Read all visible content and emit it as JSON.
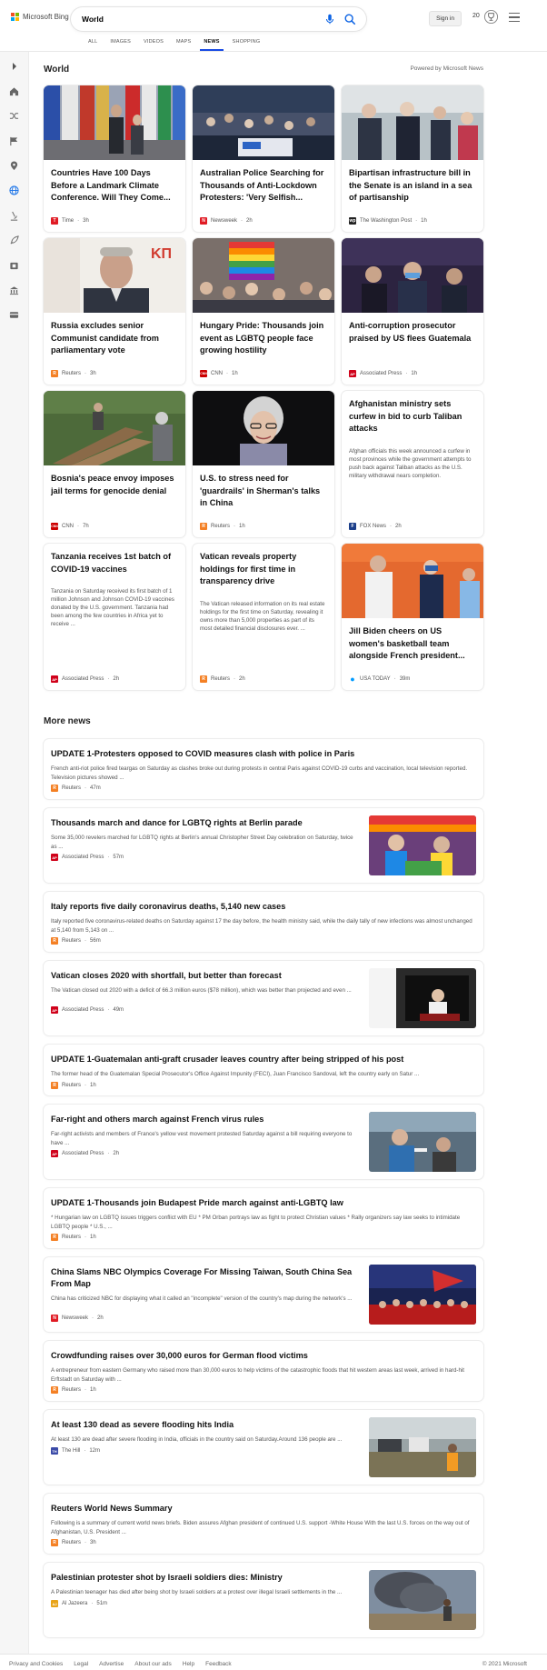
{
  "header": {
    "brand": "Microsoft Bing",
    "search_value": "World",
    "signin_label": "Sign in",
    "rewards_count": "20",
    "colors": {
      "accent": "#174ae4",
      "mic": "#0c63e4"
    }
  },
  "tabs": [
    "ALL",
    "IMAGES",
    "VIDEOS",
    "MAPS",
    "NEWS",
    "SHOPPING"
  ],
  "active_tab": "NEWS",
  "sidebar_icons": [
    "expand-icon",
    "home-icon",
    "shuffle-icon",
    "flag-icon",
    "location-pin-icon",
    "globe-icon",
    "microscope-icon",
    "rocket-icon",
    "film-icon",
    "bank-icon",
    "card-icon"
  ],
  "section": {
    "title": "World",
    "powered_by": "Powered by Microsoft News"
  },
  "cards": [
    {
      "headline": "Countries Have 100 Days Before a Landmark Climate Conference. Will They Come...",
      "source": "Time",
      "age": "3h",
      "logo": "T",
      "logo_color": "#e01b24"
    },
    {
      "headline": "Australian Police Searching for Thousands of Anti-Lockdown Protesters: 'Very Selfish...",
      "source": "Newsweek",
      "age": "2h",
      "logo": "N",
      "logo_color": "#e01b24"
    },
    {
      "headline": "Bipartisan infrastructure bill in the Senate is an island in a sea of partisanship",
      "source": "The Washington Post",
      "age": "1h",
      "logo": "wp",
      "logo_color": "#222222"
    },
    {
      "headline": "Russia excludes senior Communist candidate from parliamentary vote",
      "source": "Reuters",
      "age": "3h",
      "logo": "R",
      "logo_color": "#f48024"
    },
    {
      "headline": "Hungary Pride: Thousands join event as LGBTQ people face growing hostility",
      "source": "CNN",
      "age": "1h",
      "logo": "CNN",
      "logo_color": "#cc0000"
    },
    {
      "headline": "Anti-corruption prosecutor praised by US flees Guatemala",
      "source": "Associated Press",
      "age": "1h",
      "logo": "AP",
      "logo_color": "#d0021b"
    },
    {
      "headline": "Bosnia's peace envoy imposes jail terms for genocide denial",
      "source": "CNN",
      "age": "7h",
      "logo": "CNN",
      "logo_color": "#cc0000"
    },
    {
      "headline": "U.S. to stress need for 'guardrails' in Sherman's talks in China",
      "source": "Reuters",
      "age": "1h",
      "logo": "R",
      "logo_color": "#f48024"
    },
    {
      "headline": "Afghanistan ministry sets curfew in bid to curb Taliban attacks",
      "snippet": "Afghan officials this week announced a curfew in most provinces while the government attempts to push back against Taliban attacks as the U.S. military withdrawal nears completion.",
      "source": "FOX News",
      "age": "2h",
      "logo": "F",
      "logo_color": "#1c3f8a"
    },
    {
      "headline": "Tanzania receives 1st batch of COVID-19 vaccines",
      "snippet": "Tanzania on Saturday received its first batch of 1 million Johnson and Johnson COVID-19 vaccines donated by the U.S. government. Tanzania had been among the few countries in Africa yet to receive ...",
      "source": "Associated Press",
      "age": "2h",
      "logo": "AP",
      "logo_color": "#d0021b"
    },
    {
      "headline": "Vatican reveals property holdings for first time in transparency drive",
      "snippet": "The Vatican released information on its real estate holdings for the first time on Saturday, revealing it owns more than 5,000 properties as part of its most detailed financial disclosures ever. ...",
      "source": "Reuters",
      "age": "2h",
      "logo": "R",
      "logo_color": "#f48024"
    },
    {
      "headline": "Jill Biden cheers on US women's basketball team alongside French president...",
      "source": "USA TODAY",
      "age": "39m",
      "logo": "●",
      "logo_color": "#009bff"
    }
  ],
  "more_news": {
    "title": "More news",
    "items": [
      {
        "title": "UPDATE 1-Protesters opposed to COVID measures clash with police in Paris",
        "snippet": "French anti-riot police fired teargas on Saturday as clashes broke out during protests in central Paris against COVID-19 curbs and vaccination, local television reported. Television pictures showed ...",
        "source": "Reuters",
        "age": "47m",
        "logo": "R",
        "logo_color": "#f48024"
      },
      {
        "title": "Thousands march and dance for LGBTQ rights at Berlin parade",
        "snippet": "Some 35,000 revelers marched for LGBTQ rights at Berlin's annual Christopher Street Day celebration on Saturday, twice as ...",
        "source": "Associated Press",
        "age": "57m",
        "logo": "AP",
        "logo_color": "#d0021b"
      },
      {
        "title": "Italy reports five daily coronavirus deaths, 5,140 new cases",
        "snippet": "Italy reported five coronavirus-related deaths on Saturday against 17 the day before, the health ministry said, while the daily tally of new infections was almost unchanged at 5,140 from 5,143 on ...",
        "source": "Reuters",
        "age": "56m",
        "logo": "R",
        "logo_color": "#f48024"
      },
      {
        "title": "Vatican closes 2020 with shortfall, but better than forecast",
        "snippet": "The Vatican closed out 2020 with a deficit of 66.3 million euros ($78 million), which was better than projected and even ...",
        "source": "Associated Press",
        "age": "49m",
        "logo": "AP",
        "logo_color": "#d0021b"
      },
      {
        "title": "UPDATE 1-Guatemalan anti-graft crusader leaves country after being stripped of his post",
        "snippet": "The former head of the Guatemalan Special Prosecutor's Office Against Impunity (FECI), Juan Francisco Sandoval, left the country early on Satur ...",
        "source": "Reuters",
        "age": "1h",
        "logo": "R",
        "logo_color": "#f48024"
      },
      {
        "title": "Far-right and others march against French virus rules",
        "snippet": "Far-right activists and members of France's yellow vest movement protested Saturday against a bill requiring everyone to have ...",
        "source": "Associated Press",
        "age": "2h",
        "logo": "AP",
        "logo_color": "#d0021b"
      },
      {
        "title": "UPDATE 1-Thousands join Budapest Pride march against anti-LGBTQ law",
        "snippet": "* Hungarian law on LGBTQ issues triggers conflict with EU * PM Orban portrays law as fight to protect Christian values * Rally organizers say law seeks to intimidate LGBTQ people * U.S., ...",
        "source": "Reuters",
        "age": "1h",
        "logo": "R",
        "logo_color": "#f48024"
      },
      {
        "title": "China Slams NBC Olympics Coverage For Missing Taiwan, South China Sea From Map",
        "snippet": "China has criticized NBC for displaying what it called an \"incomplete\" version of the country's map during the network's ...",
        "source": "Newsweek",
        "age": "2h",
        "logo": "N",
        "logo_color": "#e01b24"
      },
      {
        "title": "Crowdfunding raises over 30,000 euros for German flood victims",
        "snippet": "A entrepreneur from eastern Germany who raised more than 30,000 euros to help victims of the catastrophic floods that hit western areas last week, arrived in hard-hit Erftstadt on Saturday with ...",
        "source": "Reuters",
        "age": "1h",
        "logo": "R",
        "logo_color": "#f48024"
      },
      {
        "title": "At least 130 dead as severe flooding hits India",
        "snippet": "At least 130 are dead after severe flooding in India, officials in the country said on Saturday.Around 136 people are ...",
        "source": "The Hill",
        "age": "12m",
        "logo": "TH",
        "logo_color": "#3b4ba8"
      },
      {
        "title": "Reuters World News Summary",
        "snippet": "Following is a summary of current world news briefs. Biden assures Afghan president of continued U.S. support -White House With the last U.S. forces on the way out of Afghanistan, U.S. President ...",
        "source": "Reuters",
        "age": "3h",
        "logo": "R",
        "logo_color": "#f48024"
      },
      {
        "title": "Palestinian protester shot by Israeli soldiers dies: Ministry",
        "snippet": "A Palestinian teenager has died after being shot by Israeli soldiers at a protest over illegal Israeli settlements in the ...",
        "source": "Al Jazeera",
        "age": "51m",
        "logo": "AJ",
        "logo_color": "#e8a317"
      }
    ]
  },
  "footer": {
    "links": [
      "Privacy and Cookies",
      "Legal",
      "Advertise",
      "About our ads",
      "Help",
      "Feedback"
    ],
    "copyright": "© 2021 Microsoft"
  }
}
